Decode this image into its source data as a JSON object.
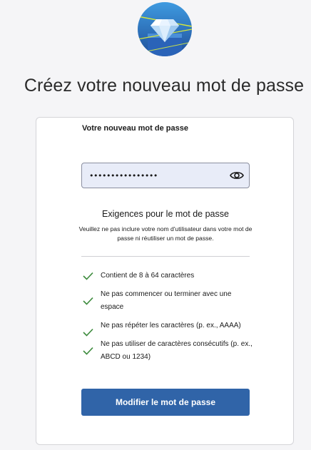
{
  "header": {
    "logo_icon": "diamond-logo-icon",
    "title": "Créez votre nouveau mot de passe"
  },
  "form": {
    "password_label": "Votre nouveau mot de passe",
    "password_value": "••••••••••••••••",
    "reveal_icon": "eye-icon"
  },
  "requirements": {
    "title": "Exigences pour le mot de passe",
    "description": "Veuillez ne pas inclure votre nom d'utilisateur dans votre mot de passe ni réutiliser un mot de passe.",
    "items": [
      {
        "label": "Contient de 8 à 64 caractères",
        "met": true
      },
      {
        "label": "Ne pas commencer ou terminer avec une espace",
        "met": true
      },
      {
        "label": "Ne pas répéter les caractères (p. ex., AAAA)",
        "met": true
      },
      {
        "label": "Ne pas utiliser de caractères consécutifs (p. ex., ABCD ou 1234)",
        "met": true
      }
    ]
  },
  "actions": {
    "submit_label": "Modifier le mot de passe"
  },
  "colors": {
    "accent": "#3064a8",
    "check": "#3c8a3c",
    "field_bg": "#e8ecf8"
  }
}
